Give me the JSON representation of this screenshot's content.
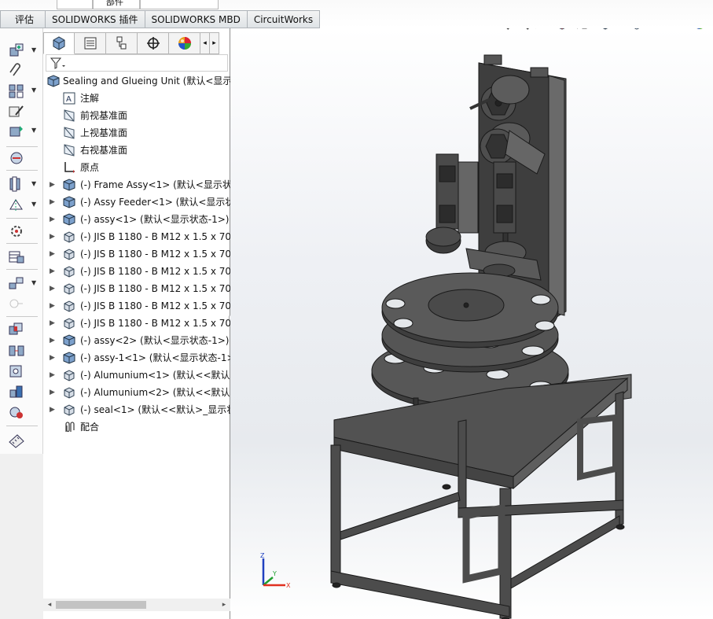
{
  "tabs": [
    "评估",
    "SOLIDWORKS 插件",
    "SOLIDWORKS MBD",
    "CircuitWorks"
  ],
  "partial_tab": "部件",
  "feature_tree": {
    "root": "Sealing and Glueing Unit  (默认<显示",
    "items": [
      {
        "label": "注解",
        "icon": "annotation-icon",
        "expand": false
      },
      {
        "label": "前视基准面",
        "icon": "plane-icon",
        "expand": false
      },
      {
        "label": "上视基准面",
        "icon": "plane-icon",
        "expand": false
      },
      {
        "label": "右视基准面",
        "icon": "plane-icon",
        "expand": false
      },
      {
        "label": "原点",
        "icon": "origin-icon",
        "expand": false
      },
      {
        "label": "(-) Frame Assy<1> (默认<显示状",
        "icon": "assembly-icon",
        "expand": true
      },
      {
        "label": "(-) Assy Feeder<1> (默认<显示状",
        "icon": "assembly-icon",
        "expand": true
      },
      {
        "label": "(-) assy<1> (默认<显示状态-1>)",
        "icon": "assembly-icon",
        "expand": true
      },
      {
        "label": "(-) JIS B 1180 - B M12 x 1.5 x 70",
        "icon": "part-icon",
        "expand": true
      },
      {
        "label": "(-) JIS B 1180 - B M12 x 1.5 x 70",
        "icon": "part-icon",
        "expand": true
      },
      {
        "label": "(-) JIS B 1180 - B M12 x 1.5 x 70",
        "icon": "part-icon",
        "expand": true
      },
      {
        "label": "(-) JIS B 1180 - B M12 x 1.5 x 70",
        "icon": "part-icon",
        "expand": true
      },
      {
        "label": "(-) JIS B 1180 - B M12 x 1.5 x 70",
        "icon": "part-icon",
        "expand": true
      },
      {
        "label": "(-) JIS B 1180 - B M12 x 1.5 x 70",
        "icon": "part-icon",
        "expand": true
      },
      {
        "label": "(-) assy<2> (默认<显示状态-1>)",
        "icon": "assembly-icon",
        "expand": true
      },
      {
        "label": "(-) assy-1<1> (默认<显示状态-1>",
        "icon": "assembly-icon",
        "expand": true
      },
      {
        "label": "(-) Alumunium<1> (默认<<默认>",
        "icon": "part-icon",
        "expand": true
      },
      {
        "label": "(-) Alumunium<2> (默认<<默认>",
        "icon": "part-icon",
        "expand": true
      },
      {
        "label": "(-) seal<1> (默认<<默认>_显示状",
        "icon": "part-icon",
        "expand": true
      },
      {
        "label": "配合",
        "icon": "mates-icon",
        "expand": false
      }
    ]
  },
  "triad": {
    "x": "X",
    "y": "Y",
    "z": "Z"
  },
  "colors": {
    "tab_bg": "#e3e6e9",
    "model_dark": "#4a4a4a",
    "model_light": "#707070",
    "axis_x": "#e03020",
    "axis_y": "#20a030",
    "axis_z": "#2040c0"
  }
}
